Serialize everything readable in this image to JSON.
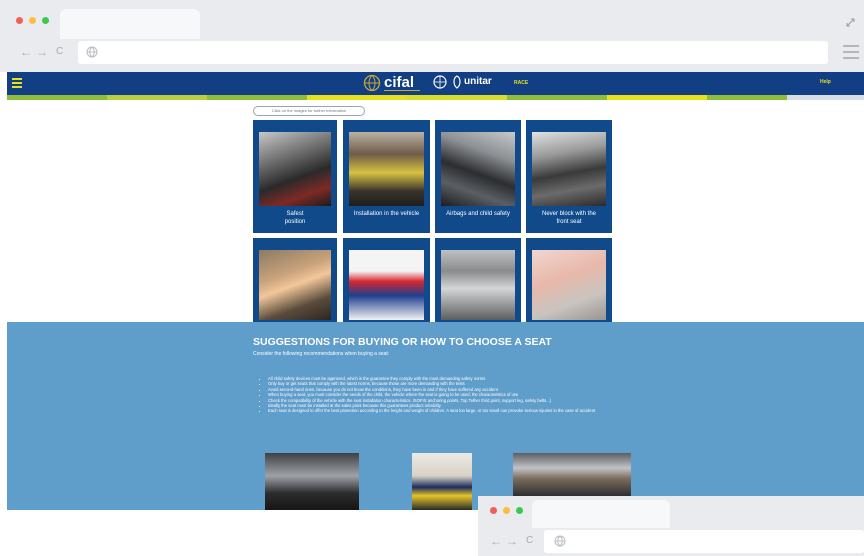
{
  "browser": {
    "nav_back": "←",
    "nav_forward": "→",
    "nav_reload": "C",
    "url": ""
  },
  "site": {
    "logo_cifal": "cifal",
    "logo_unitar": "unitar",
    "logo_race": "RACE",
    "help_label": "Help",
    "hint_label": "Click on the images for further information",
    "colors": {
      "header_blue": "#123f84",
      "accent_yellow": "#e7e01d",
      "accent_green": "#8fbd3d",
      "section_blue": "#5f9dcb",
      "card_blue": "#114a8b"
    }
  },
  "cards": [
    {
      "caption_line1": "Safest",
      "caption_line2": "position"
    },
    {
      "caption_line1": "Installation in the vehicle",
      "caption_line2": ""
    },
    {
      "caption_line1": "Airbags and child safety",
      "caption_line2": ""
    },
    {
      "caption_line1": "Never block with the",
      "caption_line2": "front seat"
    },
    {
      "caption_line1": "",
      "caption_line2": ""
    },
    {
      "caption_line1": "",
      "caption_line2": ""
    },
    {
      "caption_line1": "",
      "caption_line2": ""
    },
    {
      "caption_line1": "",
      "caption_line2": ""
    }
  ],
  "suggestions": {
    "title": "SUGGESTIONS FOR BUYING OR HOW TO CHOOSE A SEAT",
    "intro": "Consider the following recommendations when buying a seat:",
    "items": [
      "All child safety devices must be approved, which is the guarantee they comply with the most demanding safety norms",
      "Only buy or get seats that comply with the latest norms, because those are more demanding with the tests",
      "Avoid second-hand ones, because you do not know the conditions, they have been in and if they have suffered any accident",
      "When buying a seat, you must consider the needs of the child, the vehicle where the seat is going to be used, the characteristics of use",
      "Check the compatibility of the vehicle with the seat installation characteristics. ISOFIX anchoring points, Top Tether third point, support leg, safety belts...)",
      "Ideally the seat must be installed at the sales point because this guarantees product reliability",
      "Each seat is designed to offer the best protection according to the height and weight of children. A seat too large, or too small can provoke serious injuries in the case of accident"
    ]
  },
  "browser2": {
    "nav_back": "←",
    "nav_forward": "→",
    "nav_reload": "C"
  }
}
